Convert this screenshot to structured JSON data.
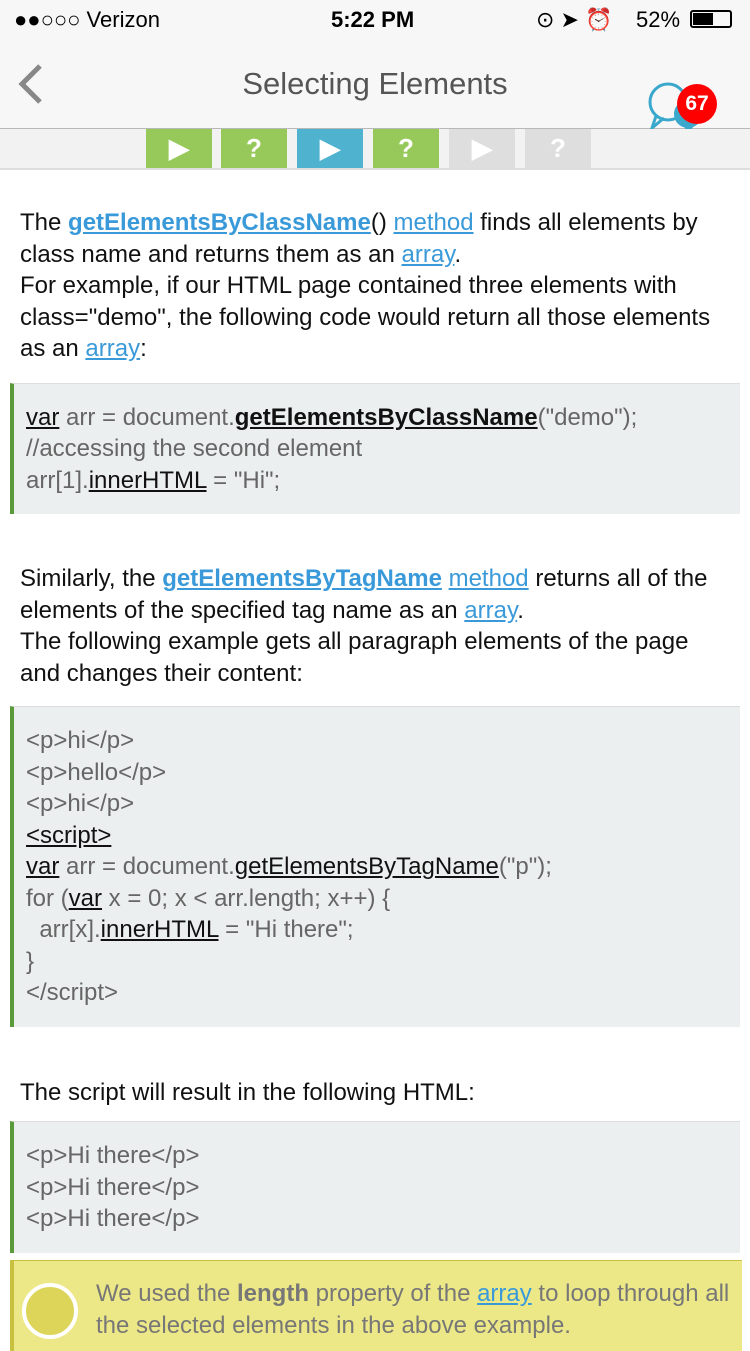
{
  "status": {
    "carrier": "●●○○○ Verizon",
    "time": "5:22 PM",
    "battery": "52%"
  },
  "nav": {
    "title": "Selecting Elements",
    "badge": "67"
  },
  "tabs": [
    {
      "glyph": "▶",
      "color": "#97c95a"
    },
    {
      "glyph": "?",
      "color": "#97c95a"
    },
    {
      "glyph": "▶",
      "color": "#4fb3cf"
    },
    {
      "glyph": "?",
      "color": "#97c95a"
    },
    {
      "glyph": "▶",
      "color": "#dedede"
    },
    {
      "glyph": "?",
      "color": "#dedede"
    }
  ],
  "p1": [
    "The ",
    "getElementsByClassName",
    "() ",
    "method",
    " finds all elements by class name and returns them as an ",
    "array",
    ". ",
    "For example, if our HTML page contained three elements with class=\"demo\", the following code would return all those elements as an ",
    "array",
    ":"
  ],
  "code1": [
    "var",
    " arr =  document.",
    "getElementsByClassName",
    "(\"demo\");",
    "//accessing the second element",
    "arr[1].",
    "innerHTML",
    " = \"Hi\";"
  ],
  "p2": [
    "Similarly, the ",
    "getElementsByTagName",
    " ",
    "method",
    " returns all of the elements of the specified tag name as an ",
    "array",
    ".",
    "The following example gets all paragraph elements of the page and changes their content:"
  ],
  "code2": [
    "<p>hi</p>",
    "<p>hello</p>",
    "<p>hi</p>",
    "<script>",
    "var",
    " arr = document.",
    "getElementsByTagName",
    "(\"p\");",
    "for (",
    "var",
    " x = 0; x < arr.length; x++) {",
    "  arr[x].",
    "innerHTML",
    " = \"Hi there\";",
    "}",
    "</script>"
  ],
  "p3": "The script will result in the following HTML:",
  "code3": [
    "<p>Hi there</p>",
    "<p>Hi there</p>",
    "<p>Hi there</p>"
  ],
  "note": [
    "We used the ",
    "length",
    " property of the ",
    "array",
    " to loop through all the selected elements in the above example."
  ]
}
